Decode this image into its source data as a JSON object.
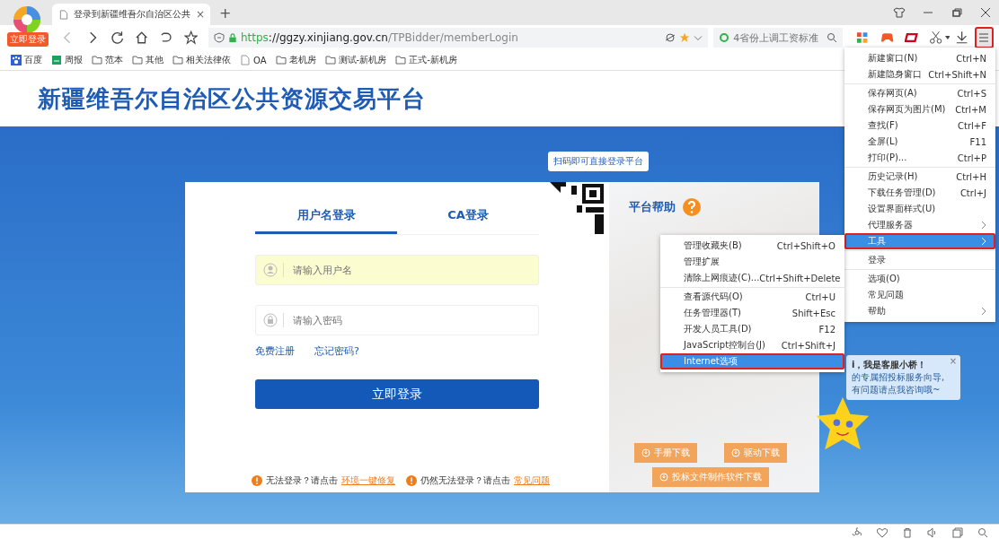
{
  "browser": {
    "logo_badge": "立即登录",
    "tab": {
      "title": "登录到新疆维吾尔自治区公共",
      "close": "×"
    },
    "new_tab": "+",
    "address": {
      "scheme": "https",
      "host": "://ggzy.xinjiang.gov.cn",
      "path": "/TPBidder/memberLogin"
    },
    "search": {
      "placeholder": "4省份上调工资标准"
    },
    "menu_button_marked": true,
    "bookmarks": [
      {
        "label": "百度",
        "kind": "paw"
      },
      {
        "label": "周报",
        "kind": "sheet"
      },
      {
        "label": "范本",
        "kind": "folder"
      },
      {
        "label": "其他",
        "kind": "folder"
      },
      {
        "label": "相关法律依",
        "kind": "folder"
      },
      {
        "label": "OA",
        "kind": "page"
      },
      {
        "label": "老机房",
        "kind": "folder"
      },
      {
        "label": "测试-新机房",
        "kind": "folder"
      },
      {
        "label": "正式-新机房",
        "kind": "folder"
      }
    ]
  },
  "page": {
    "title": "新疆维吾尔自治区公共资源交易平台",
    "qr_tooltip": "扫码即可直接登录平台",
    "tabs": [
      {
        "label": "用户名登录",
        "selected": true
      },
      {
        "label": "CA登录",
        "selected": false
      }
    ],
    "username": {
      "placeholder": "请输入用户名",
      "autofilled": true
    },
    "password": {
      "placeholder": "请输入密码",
      "autofilled": false
    },
    "links": [
      "免费注册",
      "忘记密码?"
    ],
    "submit": "立即登录",
    "notes": [
      {
        "text": "无法登录？请点击",
        "link": "环境一键修复"
      },
      {
        "text": "仍然无法登录？请点击",
        "link": "常见问题"
      }
    ],
    "help_title": "平台帮助",
    "downloads": [
      "手册下载",
      "驱动下载",
      "投标文件制作软件下载"
    ],
    "chat": {
      "lines": [
        "i，我是客服小桥！",
        "的专属招投标服务向导,",
        "有问题请点我咨询哦~"
      ],
      "close": "×"
    }
  },
  "menu": {
    "groups": [
      {
        "items": [
          {
            "label": "新建窗口(N)",
            "shortcut": "Ctrl+N",
            "selected": false,
            "arrow": false,
            "marked": false
          },
          {
            "label": "新建隐身窗口",
            "shortcut": "Ctrl+Shift+N",
            "selected": false,
            "arrow": false,
            "marked": false
          }
        ]
      },
      {
        "items": [
          {
            "label": "保存网页(A)",
            "shortcut": "Ctrl+S",
            "selected": false,
            "arrow": false,
            "marked": false
          },
          {
            "label": "保存网页为图片(M)",
            "shortcut": "Ctrl+M",
            "selected": false,
            "arrow": false,
            "marked": false
          },
          {
            "label": "查找(F)",
            "shortcut": "Ctrl+F",
            "selected": false,
            "arrow": false,
            "marked": false
          },
          {
            "label": "全屏(L)",
            "shortcut": "F11",
            "selected": false,
            "arrow": false,
            "marked": false
          },
          {
            "label": "打印(P)...",
            "shortcut": "Ctrl+P",
            "selected": false,
            "arrow": false,
            "marked": false
          }
        ]
      },
      {
        "items": [
          {
            "label": "历史记录(H)",
            "shortcut": "Ctrl+H",
            "selected": false,
            "arrow": false,
            "marked": false
          },
          {
            "label": "下载任务管理(D)",
            "shortcut": "Ctrl+J",
            "selected": false,
            "arrow": false,
            "marked": false
          },
          {
            "label": "设置界面样式(U)",
            "selected": false,
            "arrow": false,
            "marked": false
          },
          {
            "label": "代理服务器",
            "selected": false,
            "arrow": true,
            "marked": false
          },
          {
            "label": "工具",
            "selected": true,
            "arrow": true,
            "marked": true
          }
        ]
      },
      {
        "items": [
          {
            "label": "登录",
            "selected": false,
            "arrow": false,
            "marked": false
          }
        ]
      },
      {
        "items": [
          {
            "label": "选项(O)",
            "selected": false,
            "arrow": false,
            "marked": false
          },
          {
            "label": "常见问题",
            "selected": false,
            "arrow": false,
            "marked": false
          },
          {
            "label": "帮助",
            "selected": false,
            "arrow": true,
            "marked": false
          }
        ]
      }
    ]
  },
  "submenu": {
    "groups": [
      {
        "items": [
          {
            "label": "管理收藏夹(B)",
            "shortcut": "Ctrl+Shift+O",
            "selected": false,
            "marked": false
          },
          {
            "label": "管理扩展",
            "selected": false,
            "marked": false
          },
          {
            "label": "清除上网痕迹(C)...",
            "shortcut": "Ctrl+Shift+Delete",
            "selected": false,
            "marked": false
          }
        ]
      },
      {
        "items": [
          {
            "label": "查看源代码(O)",
            "shortcut": "Ctrl+U",
            "selected": false,
            "marked": false
          },
          {
            "label": "任务管理器(T)",
            "shortcut": "Shift+Esc",
            "selected": false,
            "marked": false
          },
          {
            "label": "开发人员工具(D)",
            "shortcut": "F12",
            "selected": false,
            "marked": false
          },
          {
            "label": "JavaScript控制台(J)",
            "shortcut": "Ctrl+Shift+J",
            "selected": false,
            "marked": false
          },
          {
            "label": "Internet选项",
            "selected": true,
            "marked": true
          }
        ]
      }
    ]
  }
}
